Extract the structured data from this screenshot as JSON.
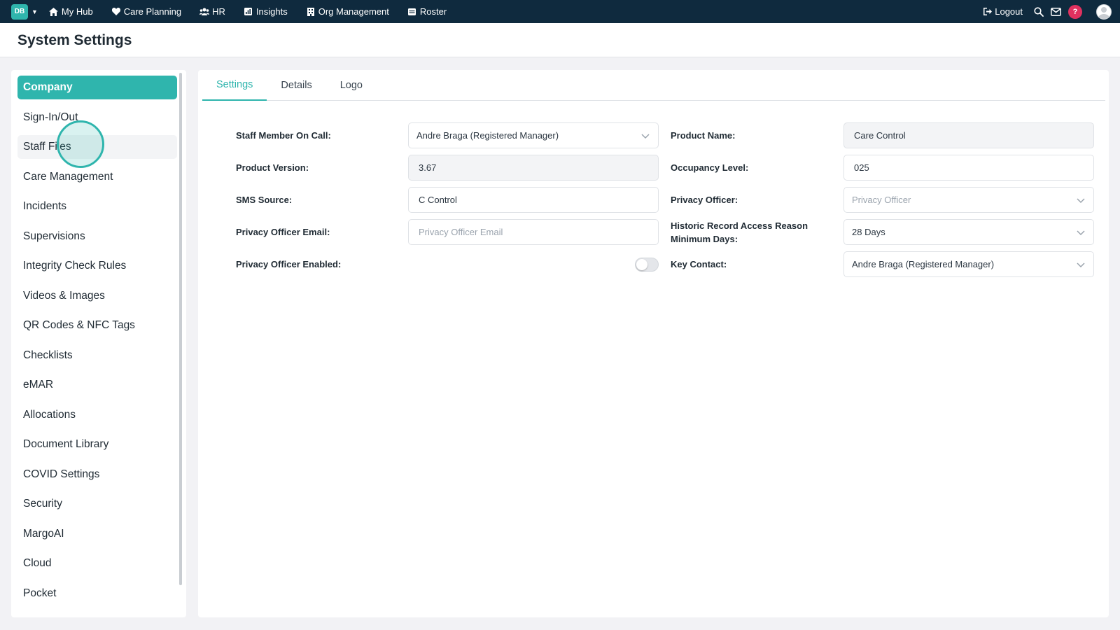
{
  "nav": {
    "badge": "DB",
    "items": [
      {
        "label": "My Hub",
        "icon": "home-icon"
      },
      {
        "label": "Care Planning",
        "icon": "heart-icon"
      },
      {
        "label": "HR",
        "icon": "users-icon"
      },
      {
        "label": "Insights",
        "icon": "chart-icon"
      },
      {
        "label": "Org Management",
        "icon": "building-icon"
      },
      {
        "label": "Roster",
        "icon": "calendar-icon"
      }
    ],
    "logout": "Logout",
    "help": "?"
  },
  "page": {
    "title": "System Settings"
  },
  "sidebar": {
    "items": [
      {
        "label": "Company"
      },
      {
        "label": "Sign-In/Out"
      },
      {
        "label": "Staff Files"
      },
      {
        "label": "Care Management"
      },
      {
        "label": "Incidents"
      },
      {
        "label": "Supervisions"
      },
      {
        "label": "Integrity Check Rules"
      },
      {
        "label": "Videos & Images"
      },
      {
        "label": "QR Codes & NFC Tags"
      },
      {
        "label": "Checklists"
      },
      {
        "label": "eMAR"
      },
      {
        "label": "Allocations"
      },
      {
        "label": "Document Library"
      },
      {
        "label": "COVID Settings"
      },
      {
        "label": "Security"
      },
      {
        "label": "MargoAI"
      },
      {
        "label": "Cloud"
      },
      {
        "label": "Pocket"
      }
    ],
    "active": "Company",
    "hovered": "Staff Files"
  },
  "tabs": [
    {
      "label": "Settings",
      "active": true
    },
    {
      "label": "Details",
      "active": false
    },
    {
      "label": "Logo",
      "active": false
    }
  ],
  "form": {
    "staff_on_call": {
      "label": "Staff Member On Call:",
      "value": "Andre Braga (Registered Manager)"
    },
    "product_name": {
      "label": "Product Name:",
      "value": "Care Control"
    },
    "product_version": {
      "label": "Product Version:",
      "value": "3.67"
    },
    "occupancy_level": {
      "label": "Occupancy Level:",
      "value": "025"
    },
    "sms_source": {
      "label": "SMS Source:",
      "value": "C Control"
    },
    "privacy_officer": {
      "label": "Privacy Officer:",
      "placeholder": "Privacy Officer"
    },
    "privacy_officer_email": {
      "label": "Privacy Officer Email:",
      "placeholder": "Privacy Officer Email"
    },
    "historic_record_days": {
      "label_line1": "Historic Record Access Reason",
      "label_line2": "Minimum Days:",
      "value": "28 Days"
    },
    "privacy_officer_enabled": {
      "label": "Privacy Officer Enabled:",
      "enabled": false
    },
    "key_contact": {
      "label": "Key Contact:",
      "value": "Andre Braga (Registered Manager)"
    }
  },
  "colors": {
    "topbar": "#0f2a3e",
    "accent": "#2fb5ad",
    "help_badge": "#e0315f"
  }
}
